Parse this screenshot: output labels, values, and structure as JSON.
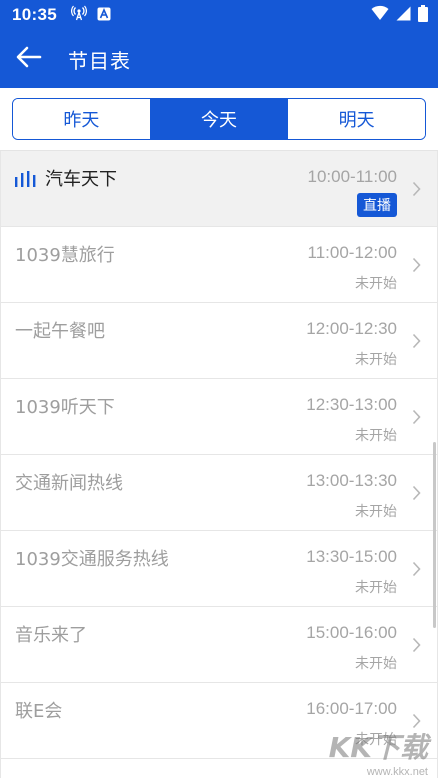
{
  "status_bar": {
    "time": "10:35",
    "icons": [
      "antenna-icon",
      "a-notification-icon",
      "wifi-icon",
      "signal-icon",
      "battery-icon"
    ]
  },
  "app_bar": {
    "title": "节目表",
    "back_icon": "arrow-left-icon"
  },
  "day_tabs": [
    {
      "label": "昨天",
      "active": false
    },
    {
      "label": "今天",
      "active": true
    },
    {
      "label": "明天",
      "active": false
    }
  ],
  "programs": [
    {
      "name": "汽车天下",
      "time": "10:00-11:00",
      "status": "直播",
      "live": true
    },
    {
      "name": "1039慧旅行",
      "time": "11:00-12:00",
      "status": "未开始",
      "live": false
    },
    {
      "name": "一起午餐吧",
      "time": "12:00-12:30",
      "status": "未开始",
      "live": false
    },
    {
      "name": "1039听天下",
      "time": "12:30-13:00",
      "status": "未开始",
      "live": false
    },
    {
      "name": "交通新闻热线",
      "time": "13:00-13:30",
      "status": "未开始",
      "live": false
    },
    {
      "name": "1039交通服务热线",
      "time": "13:30-15:00",
      "status": "未开始",
      "live": false
    },
    {
      "name": "音乐来了",
      "time": "15:00-16:00",
      "status": "未开始",
      "live": false
    },
    {
      "name": "联E会",
      "time": "16:00-17:00",
      "status": "未开始",
      "live": false
    }
  ],
  "watermark": {
    "text": "KK下载",
    "url": "www.kkx.net"
  },
  "colors": {
    "accent": "#1558d6",
    "muted_text": "#9e9e9e",
    "live_row_bg": "#f1f1f1"
  }
}
